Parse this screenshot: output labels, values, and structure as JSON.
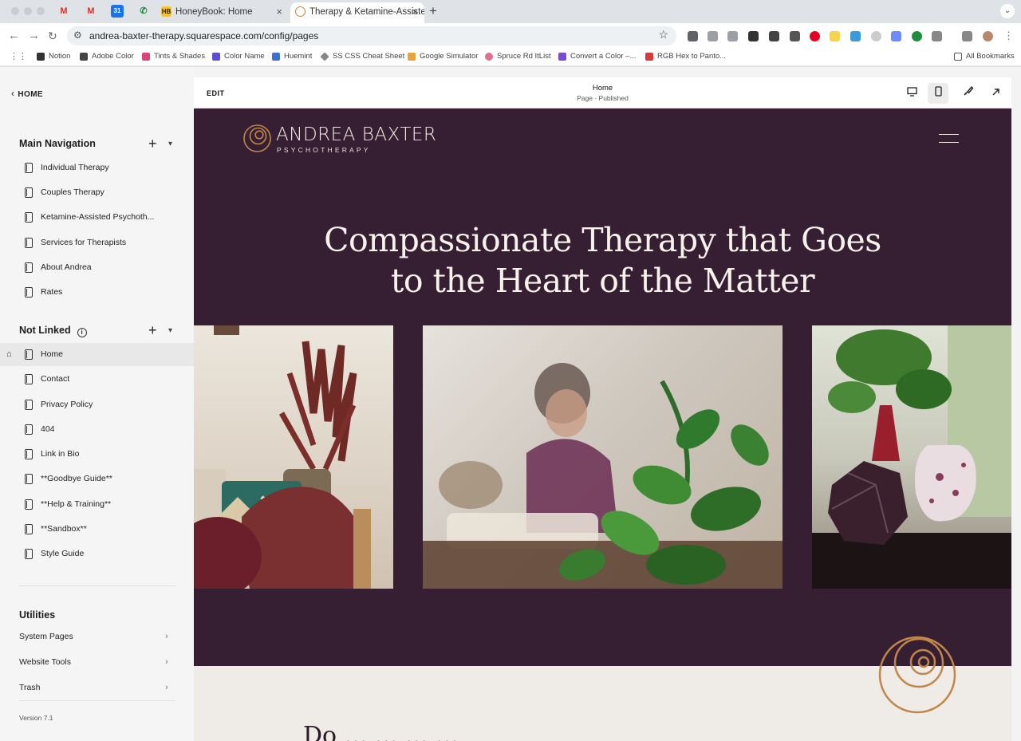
{
  "browser": {
    "tabs": [
      {
        "label": "HoneyBook: Home",
        "icon": "honeybook-icon",
        "icon_text": "HB"
      },
      {
        "label": "Therapy & Ketamine-Assisted",
        "icon": "squarespace-icon"
      }
    ],
    "tab_close": "×",
    "new_tab": "+",
    "url": "andrea-baxter-therapy.squarespace.com/config/pages",
    "bookmarks": [
      {
        "label": "Notion",
        "color": "#333333"
      },
      {
        "label": "Adobe Color",
        "color": "#444444"
      },
      {
        "label": "Tints & Shades",
        "color": "#d9467a"
      },
      {
        "label": "Color Name",
        "color": "#5b4dd6"
      },
      {
        "label": "Huemint",
        "color": "#3a6fd8"
      },
      {
        "label": "SS CSS Cheat Sheet",
        "color": "#888888"
      },
      {
        "label": "Google Simulator",
        "color": "#e8a33a"
      },
      {
        "label": "Spruce Rd ItList",
        "color": "#e06e8e"
      },
      {
        "label": "Convert a Color –...",
        "color": "#7a4bd0"
      },
      {
        "label": "RGB Hex to Panto...",
        "color": "#d93a3a"
      }
    ],
    "all_bookmarks": "All Bookmarks"
  },
  "sidebar": {
    "back_label": "HOME",
    "main_navigation": {
      "title": "Main Navigation",
      "items": [
        "Individual Therapy",
        "Couples Therapy",
        "Ketamine-Assisted Psychoth...",
        "Services for Therapists",
        "About Andrea",
        "Rates"
      ]
    },
    "not_linked": {
      "title": "Not Linked",
      "items": [
        "Home",
        "Contact",
        "Privacy Policy",
        "404",
        "Link in Bio",
        "**Goodbye Guide**",
        "**Help & Training**",
        "**Sandbox**",
        "Style Guide"
      ],
      "selected": "Home"
    },
    "utilities": {
      "title": "Utilities",
      "items": [
        "System Pages",
        "Website Tools",
        "Trash"
      ]
    },
    "version": "Version 7.1"
  },
  "editor": {
    "edit_label": "EDIT",
    "page_title": "Home",
    "page_status": "Page · Published",
    "view_mode": "desktop"
  },
  "site": {
    "logo_name": "ANDREA BAXTER",
    "logo_sub": "PSYCHOTHERAPY",
    "hero_line1": "Compassionate Therapy that Goes",
    "hero_line2": "to the Heart of the Matter",
    "below_text": "Do ... ... ... ...",
    "colors": {
      "background": "#361f33",
      "accent": "#c0874a",
      "cream": "#efebe6"
    }
  }
}
